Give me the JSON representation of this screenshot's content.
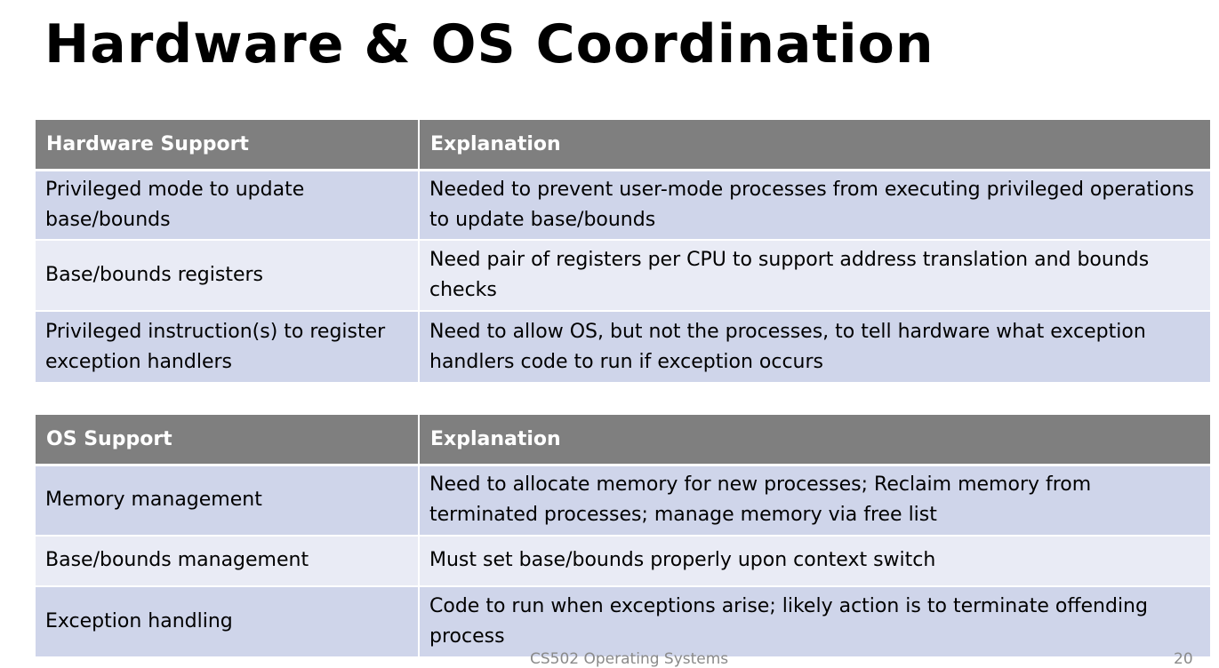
{
  "slide": {
    "title": "Hardware & OS Coordination",
    "footer": "CS502 Operating Systems",
    "page_number": "20"
  },
  "hardware_table": {
    "headers": [
      "Hardware Support",
      "Explanation"
    ],
    "rows": [
      {
        "item": "Privileged mode to update base/bounds",
        "explanation": "Needed to prevent user-mode processes from executing privileged operations to update base/bounds"
      },
      {
        "item": "Base/bounds registers",
        "explanation": "Need pair of registers per CPU to support address translation and bounds checks"
      },
      {
        "item": "Privileged instruction(s) to register exception handlers",
        "explanation": "Need to allow OS, but not the processes, to tell hardware what exception handlers code to run if exception occurs"
      }
    ]
  },
  "os_table": {
    "headers": [
      "OS Support",
      "Explanation"
    ],
    "rows": [
      {
        "item": "Memory management",
        "explanation": "Need to allocate memory for new processes; Reclaim memory from terminated processes; manage memory via free list"
      },
      {
        "item": "Base/bounds management",
        "explanation": "Must set base/bounds properly upon context switch"
      },
      {
        "item": "Exception handling",
        "explanation": "Code to run when exceptions arise; likely action is to terminate offending process"
      }
    ]
  },
  "colors": {
    "header_bg": "#7f7f7f",
    "row_dark_bg": "#cfd5ea",
    "row_light_bg": "#e9ebf5"
  }
}
